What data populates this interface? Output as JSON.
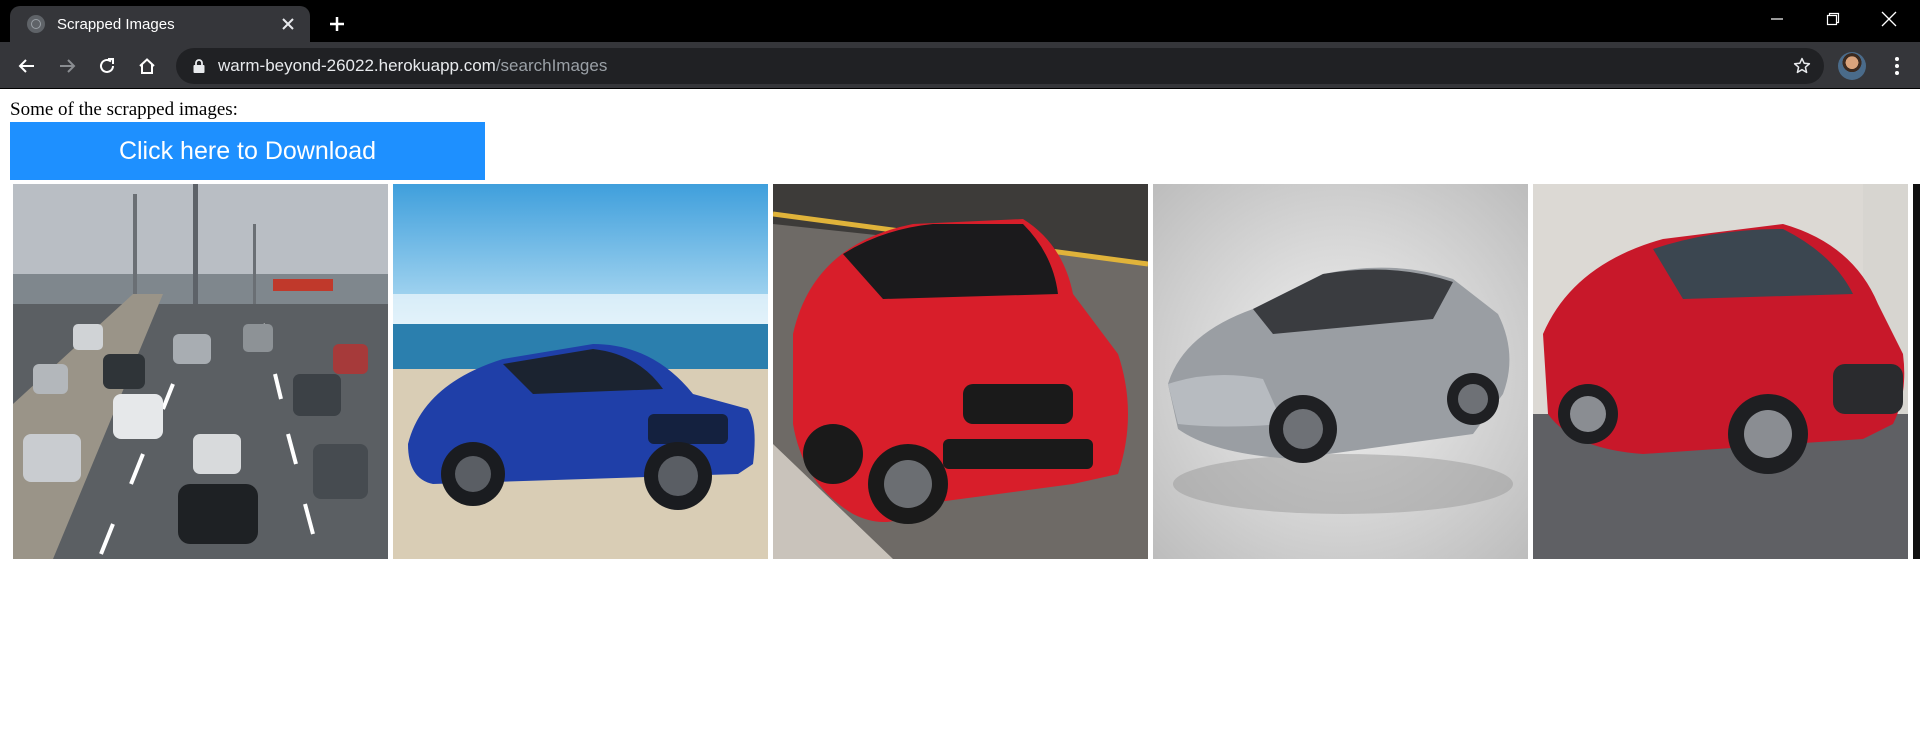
{
  "browser": {
    "tab_title": "Scrapped Images",
    "url_host": "warm-beyond-26022.herokuapp.com",
    "url_path": "/searchImages"
  },
  "page": {
    "intro_text": "Some of the scrapped images:",
    "download_button_label": "Click here to Download"
  },
  "images": [
    {
      "subject": "highway-traffic",
      "color": "#8a8f94"
    },
    {
      "subject": "blue-sedan-beach",
      "color": "#1f3fa8"
    },
    {
      "subject": "red-sports-sedan",
      "color": "#d81e2a"
    },
    {
      "subject": "silver-concept-sedan",
      "color": "#9a9ea3"
    },
    {
      "subject": "red-sedan",
      "color": "#c8182a"
    }
  ],
  "colors": {
    "download_button": "#1e90ff",
    "chrome_dark": "#35363a",
    "omnibox": "#202124"
  }
}
